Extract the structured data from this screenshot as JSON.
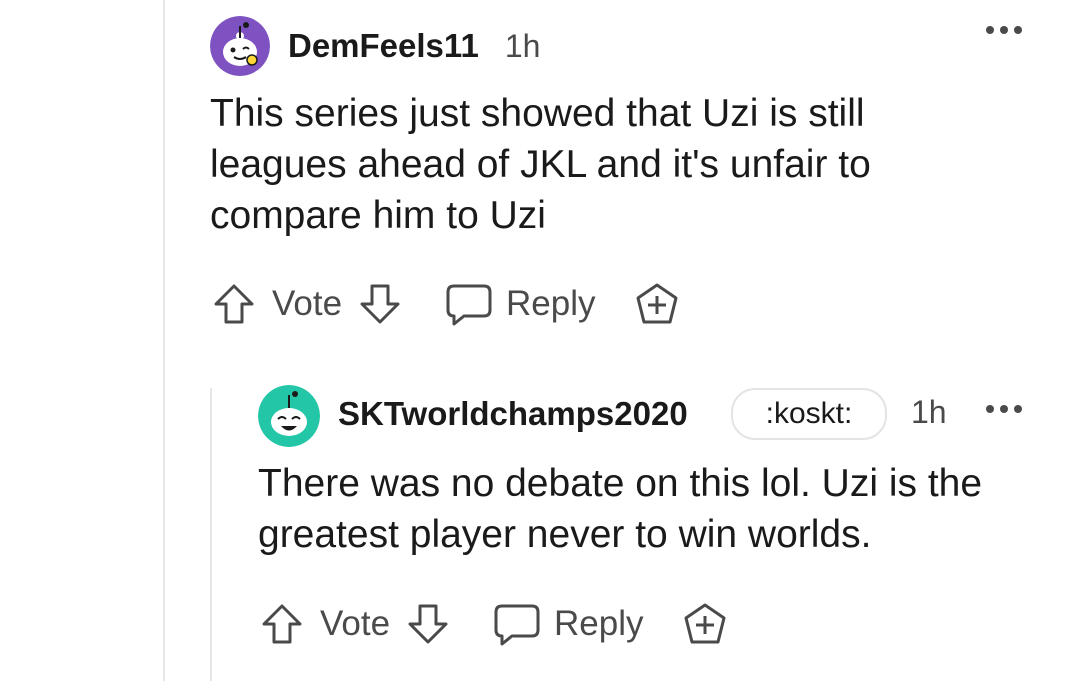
{
  "comments": [
    {
      "username": "DemFeels11",
      "time": "1h",
      "body": "This series just showed that Uzi is still leagues ahead of JKL and it's unfair to compare him to Uzi",
      "vote_label": "Vote",
      "reply_label": "Reply",
      "more_label": "•••",
      "avatar_color": "#7e53c1"
    },
    {
      "username": "SKTworldchamps2020",
      "flair": ":koskt:",
      "time": "1h",
      "body": "There was no debate on this lol. Uzi is the greatest player never to win worlds.",
      "vote_label": "Vote",
      "reply_label": "Reply",
      "more_label": "•••",
      "avatar_color": "#24c6a8"
    }
  ],
  "icons": {
    "upvote": "arrow-up-outline",
    "downvote": "arrow-down-outline",
    "reply": "speech-bubble-outline",
    "award": "plus-badge-outline",
    "more": "ellipsis"
  }
}
